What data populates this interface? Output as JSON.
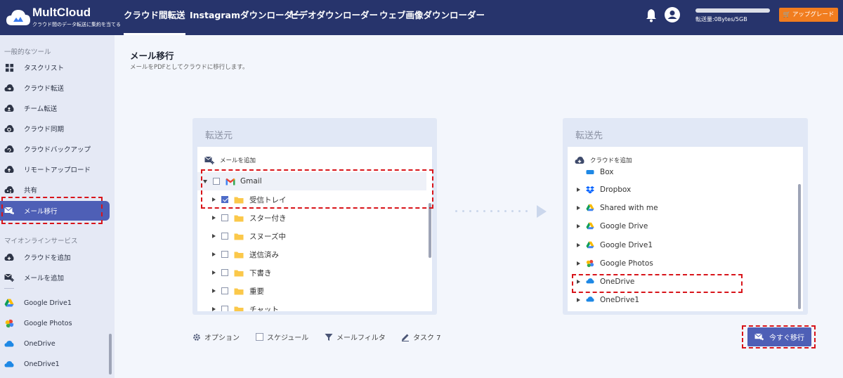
{
  "app": {
    "brand": "MultCloud",
    "tagline": "クラウド間のデータ転送に集約を当てる"
  },
  "nav": {
    "tabs": [
      {
        "label": "クラウド間転送",
        "active": true
      },
      {
        "label": "Instagramダウンローダー",
        "active": false
      },
      {
        "label": "ビデオダウンローダー",
        "active": false
      },
      {
        "label": "ウェブ画像ダウンローダー",
        "active": false
      }
    ],
    "quota": "転送量:0Bytes/5GB",
    "upgrade_label": "アップグレード"
  },
  "sidebar": {
    "section1": "一般的なツール",
    "items": [
      {
        "label": "タスクリスト",
        "icon": "grid-icon"
      },
      {
        "label": "クラウド転送",
        "icon": "cloud-transfer-icon"
      },
      {
        "label": "チーム転送",
        "icon": "team-transfer-icon"
      },
      {
        "label": "クラウド同期",
        "icon": "cloud-sync-icon"
      },
      {
        "label": "クラウドバックアップ",
        "icon": "cloud-backup-icon"
      },
      {
        "label": "リモートアップロード",
        "icon": "remote-upload-icon"
      },
      {
        "label": "共有",
        "icon": "share-icon"
      },
      {
        "label": "メール移行",
        "icon": "email-migration-icon"
      }
    ],
    "section2": "マイオンラインサービス",
    "services": [
      {
        "label": "クラウドを追加",
        "icon": "add-cloud-icon"
      },
      {
        "label": "メールを追加",
        "icon": "add-email-icon"
      },
      {
        "label": "Google Drive1",
        "icon": "google-drive-icon"
      },
      {
        "label": "Google Photos",
        "icon": "google-photos-icon"
      },
      {
        "label": "OneDrive",
        "icon": "onedrive-icon"
      },
      {
        "label": "OneDrive1",
        "icon": "onedrive-icon"
      }
    ]
  },
  "main": {
    "title": "メール移行",
    "subtitle": "メールをPDFとしてクラウドに移行します。"
  },
  "source": {
    "title": "転送元",
    "add_label": "メールを追加",
    "account": "Gmail",
    "folders": [
      {
        "label": "受信トレイ",
        "checked": true
      },
      {
        "label": "スター付き",
        "checked": false
      },
      {
        "label": "スヌーズ中",
        "checked": false
      },
      {
        "label": "送信済み",
        "checked": false
      },
      {
        "label": "下書き",
        "checked": false
      },
      {
        "label": "重要",
        "checked": false
      },
      {
        "label": "チャット",
        "checked": false
      }
    ]
  },
  "dest": {
    "title": "転送先",
    "add_label": "クラウドを追加",
    "clouds": [
      {
        "label": "Box",
        "icon": "box-icon"
      },
      {
        "label": "Dropbox",
        "icon": "dropbox-icon"
      },
      {
        "label": "Shared with me",
        "icon": "google-drive-icon"
      },
      {
        "label": "Google Drive",
        "icon": "google-drive-icon"
      },
      {
        "label": "Google Drive1",
        "icon": "google-drive-icon"
      },
      {
        "label": "Google Photos",
        "icon": "google-photos-icon"
      },
      {
        "label": "OneDrive",
        "icon": "onedrive-icon"
      },
      {
        "label": "OneDrive1",
        "icon": "onedrive-icon"
      }
    ]
  },
  "footer": {
    "options_label": "オプション",
    "schedule_label": "スケジュール",
    "filter_label": "メールフィルタ",
    "task_label": "タスク 7",
    "migrate_label": "今すぐ移行"
  },
  "colors": {
    "topbar": "#27346c",
    "accent": "#4e5fb6",
    "highlight": "#d8141a",
    "upgrade": "#f17d1f"
  }
}
